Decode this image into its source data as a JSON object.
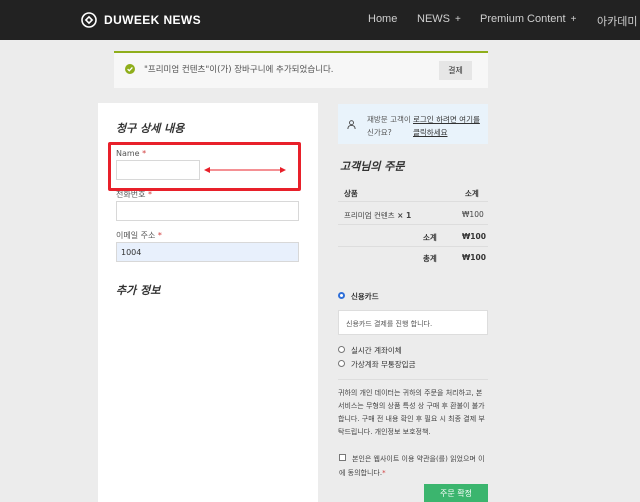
{
  "header": {
    "logo": "DUWEEK NEWS",
    "nav": [
      {
        "label": "Home",
        "plus": ""
      },
      {
        "label": "NEWS",
        "plus": "+"
      },
      {
        "label": "Premium Content",
        "plus": "+"
      },
      {
        "label": "아카데미",
        "plus": ""
      }
    ]
  },
  "notice": {
    "message": "\"프리미엄 컨텐츠\"이(가) 장바구니에 추가되었습니다.",
    "button": "결제"
  },
  "billing": {
    "title": "청구 상세 내용",
    "name_label": "Name",
    "name_value": "",
    "phone_label": "전화번호",
    "phone_value": "",
    "email_label": "이메일 주소",
    "email_value": "1004",
    "required_mark": "*",
    "extra_title": "추가 정보"
  },
  "login": {
    "returning": "재방문 고객이신가요?",
    "link": "로그인 하려면 여기를 클릭하세요"
  },
  "order": {
    "title": "고객님의 주문",
    "col_product": "상품",
    "col_subtotal": "소계",
    "item_name": "프리미엄 컨텐츠",
    "item_qty": "× 1",
    "item_price": "₩100",
    "subtotal_label": "소계",
    "subtotal_value": "₩100",
    "total_label": "총계",
    "total_value": "₩100"
  },
  "payment": {
    "options": [
      "신용카드",
      "실시간 계좌이체",
      "가상계좌 무통장입금"
    ],
    "selected": "신용카드",
    "card_desc": "신용카드 결제를 진행 합니다."
  },
  "privacy_text": "귀하의 개인 데이터는 귀하의 주문을 처리하고, 본 서비스는 무형의 상품 특성 상 구매 후 환불이 불가합니다. 구매 전 내용 확인 후 필요 시 최종 결제 부탁드립니다. 개인정보 보호정책.",
  "terms_text": "본인은 웹사이트 이용 약관을(를) 읽었으며 이에 동의합니다.",
  "place_order": "주문 확정",
  "colors": {
    "header_bg": "#222222",
    "accent_green": "#3bb56e",
    "notice_border": "#8fae1b",
    "highlight_red": "#e8202a"
  }
}
